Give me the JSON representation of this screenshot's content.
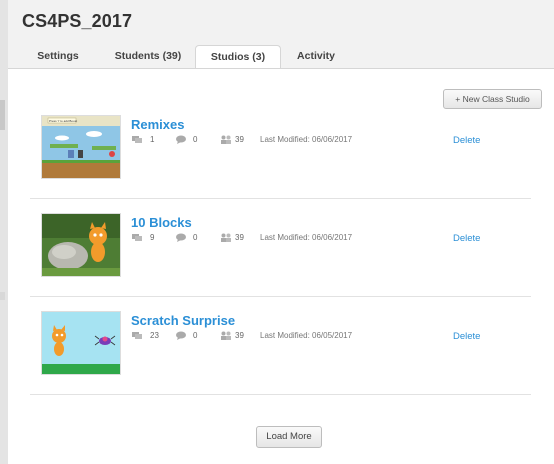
{
  "page": {
    "title": "CS4PS_2017"
  },
  "tabs": [
    {
      "label": "Settings"
    },
    {
      "label": "Students (39)"
    },
    {
      "label": "Studios (3)",
      "active": true
    },
    {
      "label": "Activity"
    }
  ],
  "toolbar": {
    "new_studio_label": "+ New Class Studio"
  },
  "studios": [
    {
      "name": "Remixes",
      "comments": "1",
      "projects": "0",
      "curators": "39",
      "modified": "Last Modified: 06/06/2017",
      "delete_label": "Delete",
      "thumbnail_title": "Press Y to add Boost"
    },
    {
      "name": "10 Blocks",
      "comments": "9",
      "projects": "0",
      "curators": "39",
      "modified": "Last Modified: 06/06/2017",
      "delete_label": "Delete"
    },
    {
      "name": "Scratch Surprise",
      "comments": "23",
      "projects": "0",
      "curators": "39",
      "modified": "Last Modified: 06/05/2017",
      "delete_label": "Delete"
    }
  ],
  "footer": {
    "load_more_label": "Load More"
  },
  "icons": {
    "comments": "comments-icon",
    "projects": "speech-bubble-icon",
    "curators": "people-icon"
  },
  "colors": {
    "link": "#2b8fd6",
    "panel": "#ffffff",
    "background": "#f2f2f2"
  }
}
